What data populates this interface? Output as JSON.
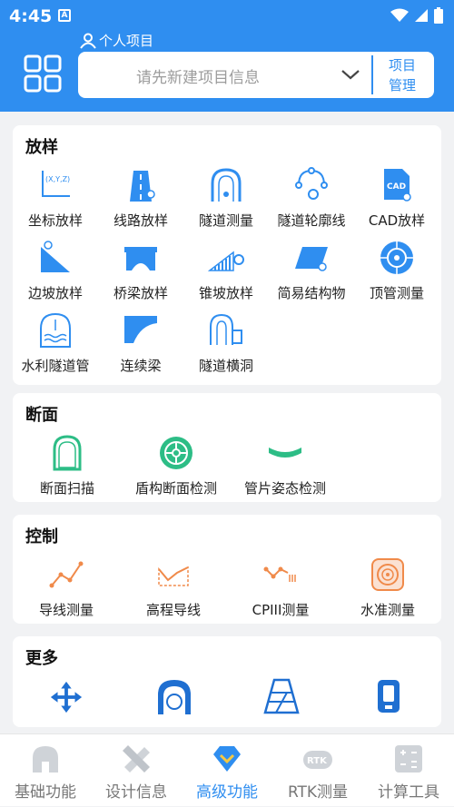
{
  "status": {
    "time": "4:45"
  },
  "header": {
    "project_label": "个人项目",
    "select_placeholder": "请先新建项目信息",
    "manage_line1": "项目",
    "manage_line2": "管理"
  },
  "sections": {
    "stakeout": {
      "title": "放样",
      "items": [
        "坐标放样",
        "线路放样",
        "隧道测量",
        "隧道轮廓线",
        "CAD放样",
        "边坡放样",
        "桥梁放样",
        "锥坡放样",
        "简易结构物",
        "顶管测量",
        "水利隧道管",
        "连续梁",
        "隧道横洞"
      ]
    },
    "section": {
      "title": "断面",
      "items": [
        "断面扫描",
        "盾构断面检测",
        "管片姿态检测"
      ]
    },
    "control": {
      "title": "控制",
      "items": [
        "导线测量",
        "高程导线",
        "CPIII测量",
        "水准测量"
      ]
    },
    "more": {
      "title": "更多"
    }
  },
  "icon_text": {
    "xyz": "(X,Y,Z)",
    "cad": "CAD",
    "rtk": "RTK"
  },
  "bottom_nav": [
    "基础功能",
    "设计信息",
    "高级功能",
    "RTK测量",
    "计算工具"
  ],
  "colors": {
    "primary": "#2f8ef0",
    "accent_green": "#2dbd86",
    "accent_orange": "#f08a4a"
  }
}
